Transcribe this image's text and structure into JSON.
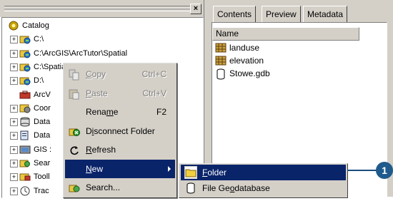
{
  "tree": {
    "close_glyph": "×",
    "items": [
      {
        "label": "Catalog",
        "icon": "catalog-icon",
        "expander": ""
      },
      {
        "label": "C:\\",
        "icon": "drive-folder-icon",
        "expander": "+"
      },
      {
        "label": "C:\\ArcGIS\\ArcTutor\\Spatial",
        "icon": "connected-folder-icon",
        "expander": "+"
      },
      {
        "label": "C:\\Spatial",
        "icon": "connected-folder-icon",
        "expander": "+"
      },
      {
        "label": "D:\\",
        "icon": "drive-folder-icon",
        "expander": "+"
      },
      {
        "label": "ArcV",
        "icon": "toolbox-icon",
        "expander": ""
      },
      {
        "label": "Coor",
        "icon": "coordinate-systems-icon",
        "expander": "+"
      },
      {
        "label": "Data",
        "icon": "database-connection-icon",
        "expander": "+"
      },
      {
        "label": "Data",
        "icon": "interop-connection-icon",
        "expander": "+"
      },
      {
        "label": "GIS :",
        "icon": "gis-servers-icon",
        "expander": "+"
      },
      {
        "label": "Sear",
        "icon": "search-results-icon",
        "expander": "+"
      },
      {
        "label": "Tooll",
        "icon": "toolboxes-icon",
        "expander": "+"
      },
      {
        "label": "Trac",
        "icon": "tracking-connections-icon",
        "expander": "+"
      }
    ]
  },
  "tabs": [
    {
      "label": "Contents"
    },
    {
      "label": "Preview"
    },
    {
      "label": "Metadata"
    }
  ],
  "contents": {
    "column_header": "Name",
    "items": [
      {
        "label": "landuse",
        "icon": "raster-icon"
      },
      {
        "label": "elevation",
        "icon": "raster-icon"
      },
      {
        "label": "Stowe.gdb",
        "icon": "geodatabase-icon"
      }
    ]
  },
  "context_menu": {
    "items": [
      {
        "pre": "",
        "mnemonic": "C",
        "post": "opy",
        "shortcut": "Ctrl+C",
        "state": "disabled",
        "icon": "copy-icon"
      },
      {
        "pre": "",
        "mnemonic": "P",
        "post": "aste",
        "shortcut": "Ctrl+V",
        "state": "disabled",
        "icon": "paste-icon"
      },
      {
        "pre": "Rena",
        "mnemonic": "m",
        "post": "e",
        "shortcut": "F2",
        "state": "enabled",
        "icon": ""
      },
      {
        "pre": "D",
        "mnemonic": "i",
        "post": "sconnect Folder",
        "shortcut": "",
        "state": "enabled",
        "icon": "disconnect-folder-icon"
      },
      {
        "pre": "",
        "mnemonic": "R",
        "post": "efresh",
        "shortcut": "",
        "state": "enabled",
        "icon": "refresh-icon"
      },
      {
        "pre": "",
        "mnemonic": "N",
        "post": "ew",
        "shortcut": "",
        "state": "highlighted",
        "icon": ""
      },
      {
        "pre": "Search...",
        "mnemonic": "",
        "post": "",
        "shortcut": "",
        "state": "enabled",
        "icon": "search-icon"
      }
    ]
  },
  "sub_menu": {
    "items": [
      {
        "pre": "",
        "mnemonic": "F",
        "post": "older",
        "state": "highlighted",
        "icon": "folder-icon"
      },
      {
        "pre": "File Ge",
        "mnemonic": "o",
        "post": "database",
        "state": "enabled",
        "icon": "file-geodatabase-icon"
      }
    ]
  },
  "callout": {
    "label": "1"
  },
  "colors": {
    "highlight": "#0a246a",
    "menu_bg": "#d4d0c8",
    "callout": "#1f5a8c"
  }
}
